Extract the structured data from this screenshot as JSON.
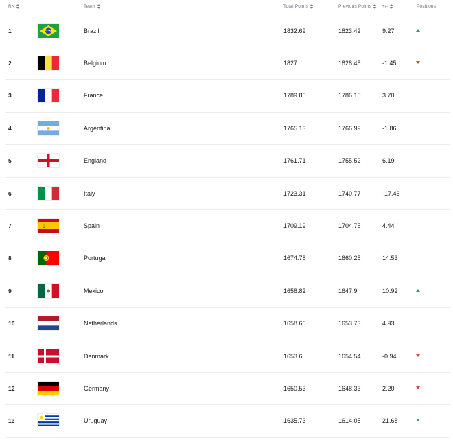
{
  "header": {
    "rk": "RK",
    "team": "Team",
    "total": "Total Points",
    "previous": "Previous Points",
    "diff": "+/-",
    "positions": "Positions"
  },
  "rows": [
    {
      "rank": "1",
      "team": "Brazil",
      "total": "1832.69",
      "previous": "1823.42",
      "diff": "9.27",
      "movement": "up",
      "flag": "brazil-flag-icon"
    },
    {
      "rank": "2",
      "team": "Belgium",
      "total": "1827",
      "previous": "1828.45",
      "diff": "-1.45",
      "movement": "down",
      "flag": "belgium-flag-icon"
    },
    {
      "rank": "3",
      "team": "France",
      "total": "1789.85",
      "previous": "1786.15",
      "diff": "3.70",
      "movement": "none",
      "flag": "france-flag-icon"
    },
    {
      "rank": "4",
      "team": "Argentina",
      "total": "1765.13",
      "previous": "1766.99",
      "diff": "-1.86",
      "movement": "none",
      "flag": "argentina-flag-icon"
    },
    {
      "rank": "5",
      "team": "England",
      "total": "1761.71",
      "previous": "1755.52",
      "diff": "6.19",
      "movement": "none",
      "flag": "england-flag-icon"
    },
    {
      "rank": "6",
      "team": "Italy",
      "total": "1723.31",
      "previous": "1740.77",
      "diff": "-17.46",
      "movement": "none",
      "flag": "italy-flag-icon"
    },
    {
      "rank": "7",
      "team": "Spain",
      "total": "1709.19",
      "previous": "1704.75",
      "diff": "4.44",
      "movement": "none",
      "flag": "spain-flag-icon"
    },
    {
      "rank": "8",
      "team": "Portugal",
      "total": "1674.78",
      "previous": "1660.25",
      "diff": "14.53",
      "movement": "none",
      "flag": "portugal-flag-icon"
    },
    {
      "rank": "9",
      "team": "Mexico",
      "total": "1658.82",
      "previous": "1647.9",
      "diff": "10.92",
      "movement": "up",
      "flag": "mexico-flag-icon"
    },
    {
      "rank": "10",
      "team": "Netherlands",
      "total": "1658.66",
      "previous": "1653.73",
      "diff": "4.93",
      "movement": "none",
      "flag": "netherlands-flag-icon"
    },
    {
      "rank": "11",
      "team": "Denmark",
      "total": "1653.6",
      "previous": "1654.54",
      "diff": "-0.94",
      "movement": "down",
      "flag": "denmark-flag-icon"
    },
    {
      "rank": "12",
      "team": "Germany",
      "total": "1650.53",
      "previous": "1648.33",
      "diff": "2.20",
      "movement": "down",
      "flag": "germany-flag-icon"
    },
    {
      "rank": "13",
      "team": "Uruguay",
      "total": "1635.73",
      "previous": "1614.05",
      "diff": "21.68",
      "movement": "up",
      "flag": "uruguay-flag-icon"
    }
  ],
  "colors": {
    "up": "#2e9e5b",
    "down": "#d6463a",
    "header_text": "#6b7280",
    "divider": "#ececec"
  }
}
